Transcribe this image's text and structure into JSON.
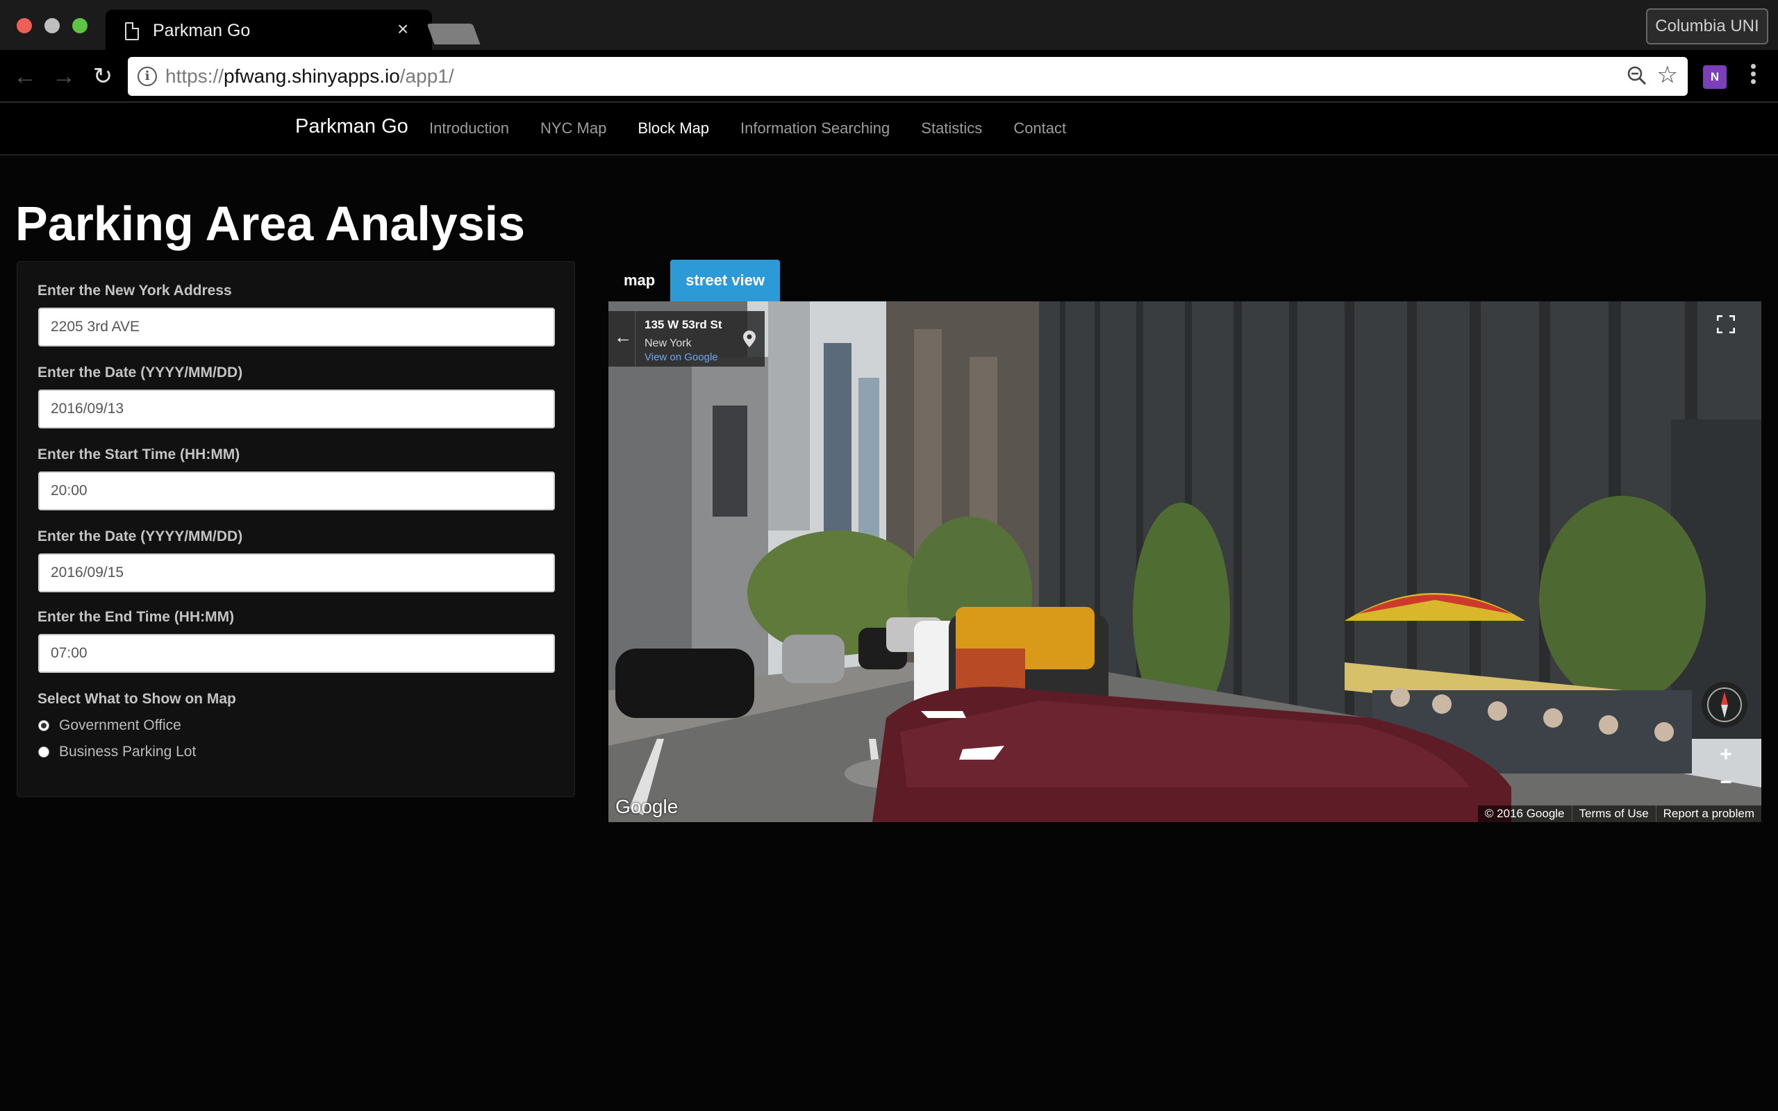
{
  "browser": {
    "tab_title": "Parkman Go",
    "tab_close": "×",
    "profile_label": "Columbia UNI",
    "url_scheme": "https://",
    "url_host": "pfwang.shinyapps.io",
    "url_path": "/app1/",
    "back_glyph": "←",
    "forward_glyph": "→",
    "reload_glyph": "↻",
    "star_glyph": "☆",
    "onenote_label": "N"
  },
  "app_nav": {
    "brand": "Parkman Go",
    "links": [
      {
        "label": "Introduction",
        "active": false
      },
      {
        "label": "NYC Map",
        "active": false
      },
      {
        "label": "Block Map",
        "active": true
      },
      {
        "label": "Information Searching",
        "active": false
      },
      {
        "label": "Statistics",
        "active": false
      },
      {
        "label": "Contact",
        "active": false
      }
    ]
  },
  "page": {
    "title": "Parking Area Analysis"
  },
  "form": {
    "address_label": "Enter the New York Address",
    "address_value": "2205 3rd AVE",
    "start_date_label": "Enter the Date (YYYY/MM/DD)",
    "start_date_value": "2016/09/13",
    "start_time_label": "Enter the Start Time (HH:MM)",
    "start_time_value": "20:00",
    "end_date_label": "Enter the Date (YYYY/MM/DD)",
    "end_date_value": "2016/09/15",
    "end_time_label": "Enter the End Time (HH:MM)",
    "end_time_value": "07:00",
    "show_label": "Select What to Show on Map",
    "options": [
      {
        "label": "Government Office",
        "checked": true
      },
      {
        "label": "Business Parking Lot",
        "checked": false
      }
    ]
  },
  "view_tabs": {
    "map": "map",
    "street_view": "street view",
    "active": "street view"
  },
  "street_view": {
    "street": "135 W 53rd St",
    "city": "New York",
    "link": "View on Google",
    "back_glyph": "←",
    "zoom_in": "+",
    "zoom_out": "−",
    "google_logo": "Google",
    "copyright": "© 2016 Google",
    "terms": "Terms of Use",
    "report": "Report a problem"
  },
  "colors": {
    "accent": "#2c9ad6",
    "background": "#050505",
    "sidebar": "#111111"
  }
}
